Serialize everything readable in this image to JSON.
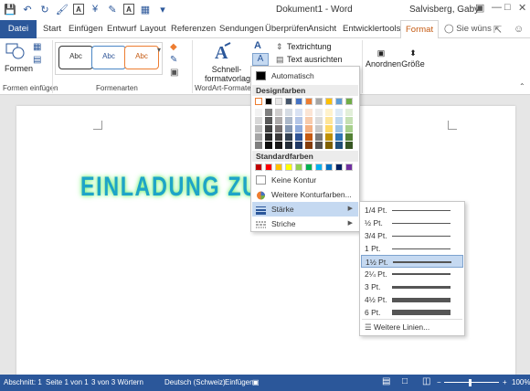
{
  "titlebar": {
    "doc_title": "Dokument1 - Word",
    "user": "Salvisberg, Gaby",
    "icons": [
      "save-icon",
      "undo-icon",
      "redo-icon",
      "format-painter-icon",
      "currency-icon",
      "text-a-icon",
      "paint-icon",
      "font-a-icon",
      "grid-icon",
      "dropdown-icon",
      "ribbon-options-icon",
      "minimize-icon",
      "maximize-icon",
      "close-icon"
    ]
  },
  "tabs": {
    "file": "Datei",
    "items": [
      "Start",
      "Einfügen",
      "Entwurf",
      "Layout",
      "Referenzen",
      "Sendungen",
      "Überprüfen",
      "Ansicht",
      "Entwicklertools"
    ],
    "active": "Format",
    "tell_me": "Sie wüns"
  },
  "ribbon": {
    "shapes_label": "Formen",
    "insert_shapes_group": "Formen einfügen",
    "style_sample": "Abc",
    "shape_styles_group": "Formenarten",
    "quick_styles_label1": "Schnell-",
    "quick_styles_label2": "formatvorlagen",
    "wordart_group": "WordArt-Formate",
    "text_direction": "Textrichtung",
    "align_text": "Text ausrichten",
    "arrange": "Anordnen",
    "size": "Größe"
  },
  "document": {
    "wordart_text": "EINLADUNG ZUM B"
  },
  "colors": {
    "accent": "#2b579a",
    "format_tab": "#c55a11",
    "wordart_fill": "#1ea4c8",
    "wordart_glow": "#7ff07a",
    "theme_row": [
      "#ffffff",
      "#000000",
      "#e7e6e6",
      "#44546a",
      "#4472c4",
      "#ed7d31",
      "#a5a5a5",
      "#ffc000",
      "#5b9bd5",
      "#70ad47"
    ],
    "theme_shades": [
      [
        "#f2f2f2",
        "#7f7f7f",
        "#d0cece",
        "#d6dce4",
        "#d9e2f3",
        "#fbe5d5",
        "#ededed",
        "#fff2cc",
        "#deebf6",
        "#e2efd9"
      ],
      [
        "#d8d8d8",
        "#595959",
        "#aeabab",
        "#adb9ca",
        "#b4c6e7",
        "#f7cbac",
        "#dbdbdb",
        "#fee599",
        "#bdd7ee",
        "#c5e0b3"
      ],
      [
        "#bfbfbf",
        "#3f3f3f",
        "#757070",
        "#8496b0",
        "#8eaadb",
        "#f4b183",
        "#c9c9c9",
        "#ffd965",
        "#9cc3e5",
        "#a8d08d"
      ],
      [
        "#a5a5a5",
        "#262626",
        "#3a3838",
        "#323f4f",
        "#2f5496",
        "#c55a11",
        "#7b7b7b",
        "#bf9000",
        "#2e75b5",
        "#538135"
      ],
      [
        "#7f7f7f",
        "#0c0c0c",
        "#171616",
        "#222a35",
        "#1f3864",
        "#833c0b",
        "#525252",
        "#7f6000",
        "#1f4e79",
        "#375623"
      ]
    ],
    "standard": [
      "#c00000",
      "#ff0000",
      "#ffc000",
      "#ffff00",
      "#92d050",
      "#00b050",
      "#00b0f0",
      "#0070c0",
      "#002060",
      "#7030a0"
    ]
  },
  "outline_menu": {
    "automatic": "Automatisch",
    "theme_colors": "Designfarben",
    "standard_colors": "Standardfarben",
    "no_outline": "Keine Kontur",
    "more_colors": "Weitere Konturfarben...",
    "weight": "Stärke",
    "dashes": "Striche"
  },
  "weight_menu": {
    "items": [
      "1/4 Pt.",
      "½ Pt.",
      "3/4 Pt.",
      "1 Pt.",
      "1½ Pt.",
      "2¼ Pt.",
      "3 Pt.",
      "4½ Pt.",
      "6 Pt."
    ],
    "weights": [
      0.25,
      0.5,
      0.75,
      1,
      1.5,
      2.25,
      3,
      4.5,
      6
    ],
    "selected": "1½ Pt.",
    "more_lines": "Weitere Linien..."
  },
  "statusbar": {
    "section": "Abschnitt: 1",
    "page": "Seite 1 von 1",
    "words": "3 von 3 Wörtern",
    "language": "Deutsch (Schweiz)",
    "mode": "Einfügen",
    "zoom": "100%"
  }
}
